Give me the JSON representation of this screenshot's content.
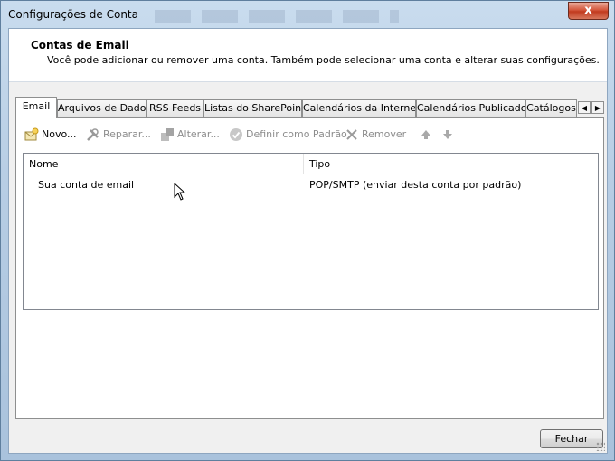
{
  "window": {
    "title": "Configurações de Conta",
    "close_glyph": "x"
  },
  "header": {
    "title": "Contas de Email",
    "description": "Você pode adicionar ou remover uma conta. Também pode selecionar uma conta e alterar suas configurações."
  },
  "tabs": [
    {
      "label": "Email",
      "active": true
    },
    {
      "label": "Arquivos de Dados",
      "active": false
    },
    {
      "label": "RSS Feeds",
      "active": false
    },
    {
      "label": "Listas do SharePoint",
      "active": false
    },
    {
      "label": "Calendários da Internet",
      "active": false
    },
    {
      "label": "Calendários Publicados",
      "active": false
    },
    {
      "label": "Catálogos",
      "active": false
    }
  ],
  "toolbar": {
    "new_label": "Novo...",
    "repair_label": "Reparar...",
    "change_label": "Alterar...",
    "default_label": "Definir como Padrão",
    "remove_label": "Remover"
  },
  "table": {
    "columns": [
      "Nome",
      "Tipo"
    ],
    "rows": [
      {
        "name": "Sua conta de email",
        "type": "POP/SMTP (enviar desta conta por padrão)"
      }
    ]
  },
  "footer": {
    "close_label": "Fechar"
  },
  "colors": {
    "frame": "#b7cde4",
    "close_red": "#c13b1f",
    "disabled_text": "#8d8d8d"
  }
}
